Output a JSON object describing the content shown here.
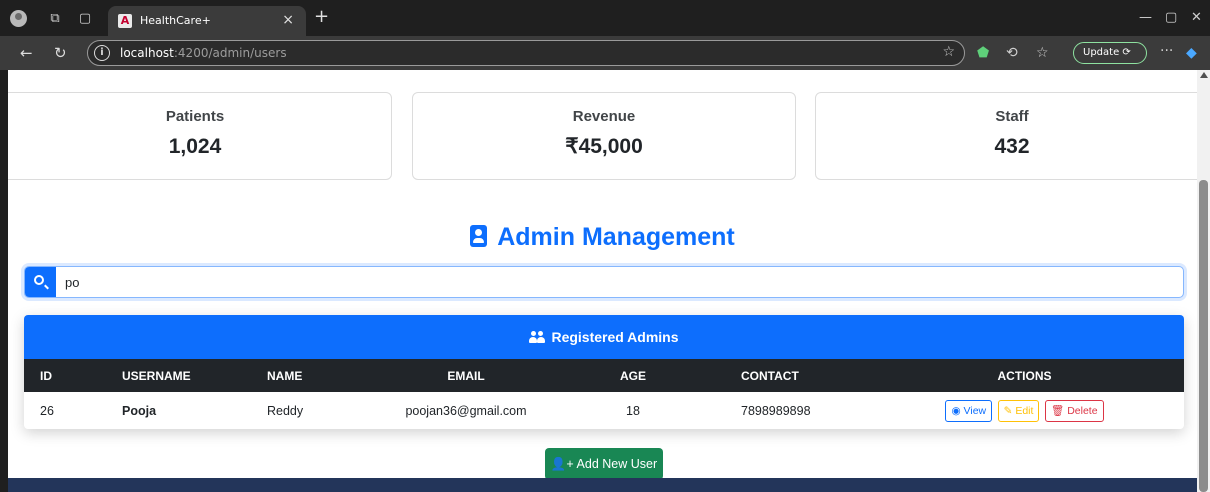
{
  "browser": {
    "tab_title": "HealthCare+",
    "tab_close": "×",
    "new_tab": "+",
    "url_host": "localhost",
    "url_rest": ":4200/admin/users",
    "update_label": "Update",
    "more": "···"
  },
  "stats": [
    {
      "label": "Patients",
      "value": "1,024"
    },
    {
      "label": "Revenue",
      "value": "₹45,000"
    },
    {
      "label": "Staff",
      "value": "432"
    }
  ],
  "page_title": "Admin Management",
  "search": {
    "value": "po"
  },
  "table": {
    "title": "Registered Admins",
    "columns": [
      "ID",
      "USERNAME",
      "NAME",
      "EMAIL",
      "AGE",
      "CONTACT",
      "ACTIONS"
    ],
    "rows": [
      {
        "id": "26",
        "username": "Pooja",
        "name": "Reddy",
        "email": "poojan36@gmail.com",
        "age": "18",
        "contact": "7898989898"
      }
    ],
    "actions": {
      "view": "View",
      "edit": "Edit",
      "delete": "Delete"
    }
  },
  "add_button": "Add New User",
  "colors": {
    "primary": "#0d6efd",
    "dark": "#212529",
    "success": "#198754",
    "warning": "#ffc107",
    "danger": "#dc3545"
  }
}
